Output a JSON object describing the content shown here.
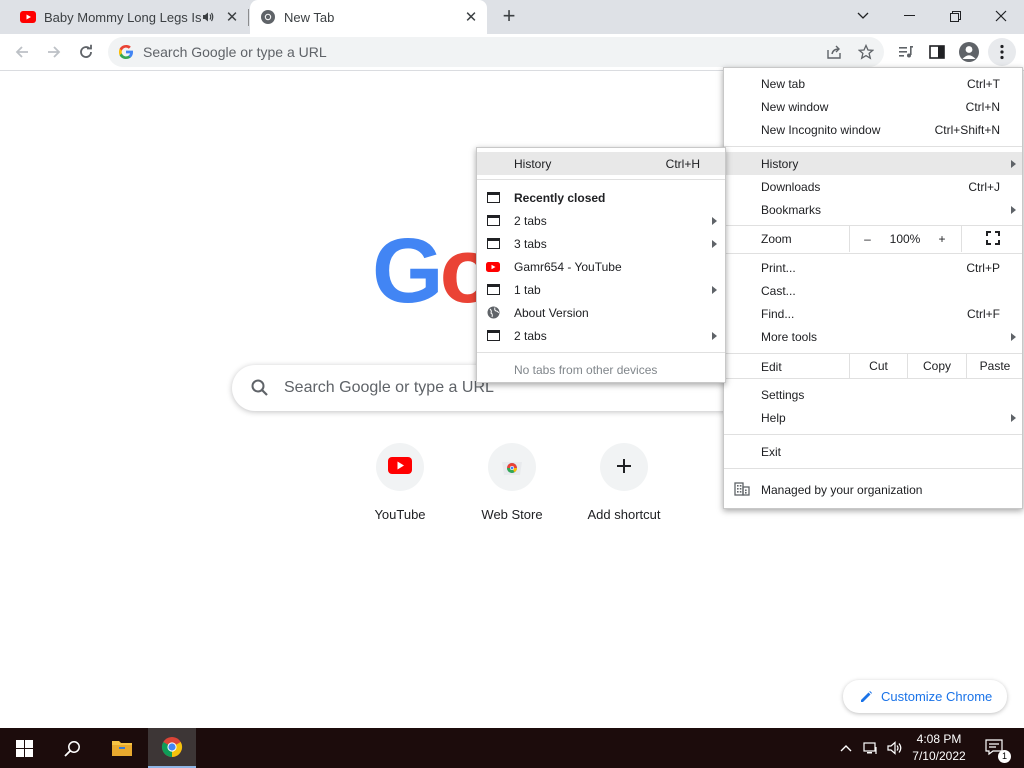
{
  "tabs": [
    {
      "title": "Baby Mommy Long Legs Is S",
      "favicon": "youtube-icon",
      "audio": true,
      "active": false
    },
    {
      "title": "New Tab",
      "favicon": "chrome-icon",
      "active": true
    }
  ],
  "toolbar": {
    "omnibox_placeholder": "Search Google or type a URL"
  },
  "ntp": {
    "logo_letters": [
      "G",
      "o"
    ],
    "search_placeholder": "Search Google or type a URL",
    "shortcuts": [
      {
        "label": "YouTube",
        "icon": "youtube-icon"
      },
      {
        "label": "Web Store",
        "icon": "web-store-icon"
      },
      {
        "label": "Add shortcut",
        "icon": "plus-icon"
      }
    ],
    "customize_label": "Customize Chrome"
  },
  "main_menu": {
    "new_tab": {
      "label": "New tab",
      "shortcut": "Ctrl+T"
    },
    "new_window": {
      "label": "New window",
      "shortcut": "Ctrl+N"
    },
    "new_incognito": {
      "label": "New Incognito window",
      "shortcut": "Ctrl+Shift+N"
    },
    "history": {
      "label": "History"
    },
    "downloads": {
      "label": "Downloads",
      "shortcut": "Ctrl+J"
    },
    "bookmarks": {
      "label": "Bookmarks"
    },
    "zoom": {
      "label": "Zoom",
      "minus": "–",
      "level": "100%",
      "plus": "+"
    },
    "print": {
      "label": "Print...",
      "shortcut": "Ctrl+P"
    },
    "cast": {
      "label": "Cast..."
    },
    "find": {
      "label": "Find...",
      "shortcut": "Ctrl+F"
    },
    "more_tools": {
      "label": "More tools"
    },
    "edit": {
      "label": "Edit",
      "cut": "Cut",
      "copy": "Copy",
      "paste": "Paste"
    },
    "settings": {
      "label": "Settings"
    },
    "help": {
      "label": "Help"
    },
    "exit": {
      "label": "Exit"
    },
    "managed": {
      "label": "Managed by your organization"
    }
  },
  "history_menu": {
    "history": {
      "label": "History",
      "shortcut": "Ctrl+H"
    },
    "recently_closed": "Recently closed",
    "items": [
      {
        "label": "2 tabs",
        "icon": "window-icon",
        "submenu": true
      },
      {
        "label": "3 tabs",
        "icon": "window-icon",
        "submenu": true
      },
      {
        "label": "Gamr654 - YouTube",
        "icon": "youtube-icon",
        "submenu": false
      },
      {
        "label": "1 tab",
        "icon": "window-icon",
        "submenu": true
      },
      {
        "label": "About Version",
        "icon": "globe-icon",
        "submenu": false
      },
      {
        "label": "2 tabs",
        "icon": "window-icon",
        "submenu": true
      }
    ],
    "no_tabs": "No tabs from other devices"
  },
  "taskbar": {
    "time": "4:08 PM",
    "date": "7/10/2022",
    "notification_count": "1"
  },
  "colors": {
    "google_blue": "#4285f4",
    "google_red": "#ea4335",
    "youtube_red": "#ff0000",
    "accent": "#1a73e8"
  }
}
